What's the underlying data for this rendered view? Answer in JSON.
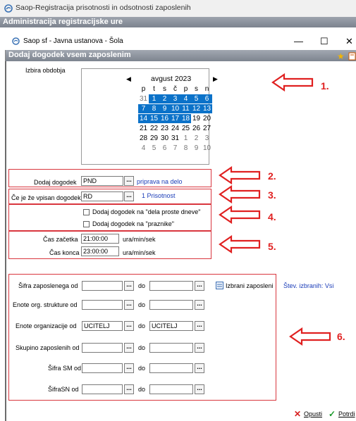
{
  "outer_window": {
    "title": "Saop-Registracija prisotnosti in odsotnosti zaposlenih",
    "app_bar_title": "Administracija registracijske ure"
  },
  "inner_window": {
    "title": "Saop sf - Javna ustanova - Šola",
    "minimize": "—",
    "maximize": "☐",
    "close": "✕"
  },
  "dialog": {
    "title": "Dodaj dogodek vsem zaposlenim"
  },
  "period": {
    "label": "Izbira obdobja",
    "calendar": {
      "month": "avgust 2023",
      "weekdays": [
        "p",
        "t",
        "s",
        "č",
        "p",
        "s",
        "n"
      ],
      "weeks": [
        [
          {
            "d": "31",
            "s": "other"
          },
          {
            "d": "1",
            "s": "sel"
          },
          {
            "d": "2",
            "s": "sel"
          },
          {
            "d": "3",
            "s": "sel"
          },
          {
            "d": "4",
            "s": "sel"
          },
          {
            "d": "5",
            "s": "sel"
          },
          {
            "d": "6",
            "s": "sel"
          }
        ],
        [
          {
            "d": "7",
            "s": "sel"
          },
          {
            "d": "8",
            "s": "sel"
          },
          {
            "d": "9",
            "s": "sel"
          },
          {
            "d": "10",
            "s": "sel"
          },
          {
            "d": "11",
            "s": "sel"
          },
          {
            "d": "12",
            "s": "sel"
          },
          {
            "d": "13",
            "s": "sel"
          }
        ],
        [
          {
            "d": "14",
            "s": "sel"
          },
          {
            "d": "15",
            "s": "sel"
          },
          {
            "d": "16",
            "s": "sel"
          },
          {
            "d": "17",
            "s": "sel"
          },
          {
            "d": "18",
            "s": "sel"
          },
          {
            "d": "19",
            "s": ""
          },
          {
            "d": "20",
            "s": ""
          }
        ],
        [
          {
            "d": "21",
            "s": ""
          },
          {
            "d": "22",
            "s": ""
          },
          {
            "d": "23",
            "s": ""
          },
          {
            "d": "24",
            "s": ""
          },
          {
            "d": "25",
            "s": ""
          },
          {
            "d": "26",
            "s": ""
          },
          {
            "d": "27",
            "s": ""
          }
        ],
        [
          {
            "d": "28",
            "s": ""
          },
          {
            "d": "29",
            "s": ""
          },
          {
            "d": "30",
            "s": ""
          },
          {
            "d": "31",
            "s": ""
          },
          {
            "d": "1",
            "s": "other"
          },
          {
            "d": "2",
            "s": "other"
          },
          {
            "d": "3",
            "s": "other"
          }
        ],
        [
          {
            "d": "4",
            "s": "other"
          },
          {
            "d": "5",
            "s": "other"
          },
          {
            "d": "6",
            "s": "other"
          },
          {
            "d": "7",
            "s": "other"
          },
          {
            "d": "8",
            "s": "other"
          },
          {
            "d": "9",
            "s": "other"
          },
          {
            "d": "10",
            "s": "other"
          }
        ]
      ]
    }
  },
  "add_event": {
    "label": "Dodaj dogodek",
    "value": "PND",
    "description": "priprava na delo"
  },
  "if_event": {
    "label": "Če je že vpisan dogodek",
    "value": "RD",
    "description": "1 Prisotnost"
  },
  "options": {
    "free_days": "Dodaj dogodek na \"dela proste dneve\"",
    "holidays": "Dodaj dogodek na \"praznike\""
  },
  "time": {
    "start_label": "Čas začetka",
    "start_value": "21:00:00",
    "end_label": "Čas konca",
    "end_value": "23:00:00",
    "unit": "ura/min/sek"
  },
  "filters": {
    "do_label": "do",
    "selected_button": "Izbrani zaposleni",
    "selected_count": "Štev. izbranih: Vsi",
    "rows": [
      {
        "label": "Šifra zaposlenega od",
        "from": "",
        "to": ""
      },
      {
        "label": "Enote org. strukture od",
        "from": "",
        "to": ""
      },
      {
        "label": "Enote organizacije od",
        "from": "UCITELJ",
        "to": "UCITELJ"
      },
      {
        "label": "Skupino zaposlenih  od",
        "from": "",
        "to": ""
      },
      {
        "label": "Šifra SM od",
        "from": "",
        "to": ""
      },
      {
        "label": "ŠifraSN od",
        "from": "",
        "to": ""
      }
    ]
  },
  "annotations": [
    "1.",
    "2.",
    "3.",
    "4.",
    "5.",
    "6."
  ],
  "colors": {
    "annotation": "#e02020",
    "selection": "#0b72c9",
    "link": "#1a3cb8"
  },
  "footer": {
    "cancel": "Opusti",
    "confirm": "Potrdi"
  }
}
